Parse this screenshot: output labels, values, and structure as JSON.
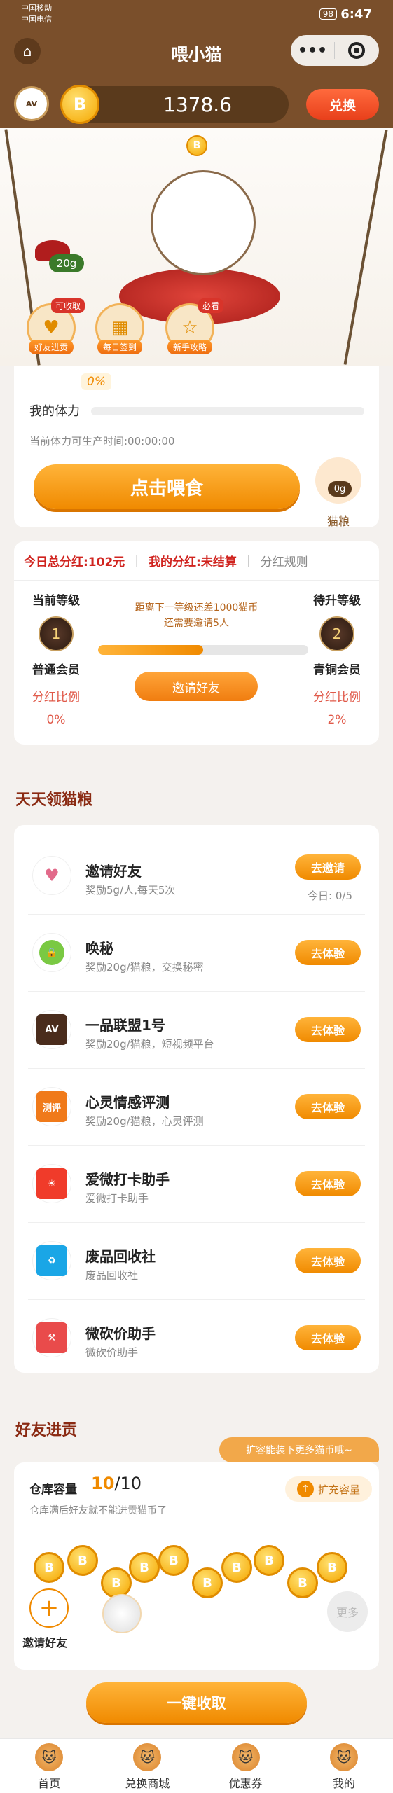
{
  "status": {
    "carrier1": "中国移动",
    "carrier2": "中国电信",
    "battery": "98",
    "time": "6:47"
  },
  "nav": {
    "title": "喂小猫",
    "more": "•••"
  },
  "wallet": {
    "logo_text": "AV",
    "coin_symbol": "B",
    "balance": "1378.6",
    "exchange": "兑换"
  },
  "hero": {
    "food_amount": "20g",
    "coin_symbol": "B",
    "buttons": [
      {
        "label": "好友进贡",
        "tag": "可收取"
      },
      {
        "label": "每日签到",
        "tag": ""
      },
      {
        "label": "新手攻略",
        "tag": "必看"
      }
    ]
  },
  "stamina": {
    "percent": "0%",
    "label": "我的体力",
    "fill_fraction": 0,
    "produce_time": "当前体力可生产时间:00:00:00",
    "feed_button": "点击喂食",
    "food_amount": "0g",
    "food_label": "猫粮"
  },
  "bonus": {
    "today_total": "今日总分红:102元",
    "my_bonus": "我的分红:未结算",
    "rules": "分红规则",
    "current": {
      "title": "当前等级",
      "badge": "1",
      "name": "普通会员",
      "ratio_label": "分红比例",
      "ratio": "0%"
    },
    "next": {
      "title": "待升等级",
      "badge": "2",
      "name": "青铜会员",
      "ratio_label": "分红比例",
      "ratio": "2%"
    },
    "line1": "距离下一等级还差1000猫币",
    "line2": "还需要邀请5人",
    "progress_fraction": 0.5,
    "invite_button": "邀请好友"
  },
  "daily": {
    "title": "天天领猫粮",
    "tasks": [
      {
        "title": "邀请好友",
        "desc": "奖励5g/人,每天5次",
        "button": "去邀请",
        "extra": "今日: 0/5",
        "icon": "card-heart-icon"
      },
      {
        "title": "唤秘",
        "desc": "奖励20g/猫粮，交换秘密",
        "button": "去体验",
        "extra": "",
        "icon": "lock-icon"
      },
      {
        "title": "一品联盟1号",
        "desc": "奖励20g/猫粮，短视频平台",
        "button": "去体验",
        "extra": "",
        "icon": "av-logo-icon"
      },
      {
        "title": "心灵情感评测",
        "desc": "奖励20g/猫粮，心灵评测",
        "button": "去体验",
        "extra": "",
        "icon": "test-icon"
      },
      {
        "title": "爱微打卡助手",
        "desc": "爱微打卡助手",
        "button": "去体验",
        "extra": "",
        "icon": "sun-icon"
      },
      {
        "title": "废品回收社",
        "desc": "废品回收社",
        "button": "去体验",
        "extra": "",
        "icon": "recycle-icon"
      },
      {
        "title": "微砍价助手",
        "desc": "微砍价助手",
        "button": "去体验",
        "extra": "",
        "icon": "hammer-icon"
      }
    ]
  },
  "friends": {
    "title": "好友进贡",
    "tooltip": "扩容能装下更多猫币哦~",
    "capacity_label": "仓库容量",
    "capacity_used": "10",
    "capacity_total": "/10",
    "capacity_note": "仓库满后好友就不能进贡猫币了",
    "expand": "扩充容量",
    "coin_symbol": "B",
    "invite_label": "邀请好友",
    "more": "更多",
    "collect_button": "一键收取"
  },
  "tabs": [
    {
      "label": "首页"
    },
    {
      "label": "兑换商城"
    },
    {
      "label": "优惠券"
    },
    {
      "label": "我的"
    }
  ]
}
